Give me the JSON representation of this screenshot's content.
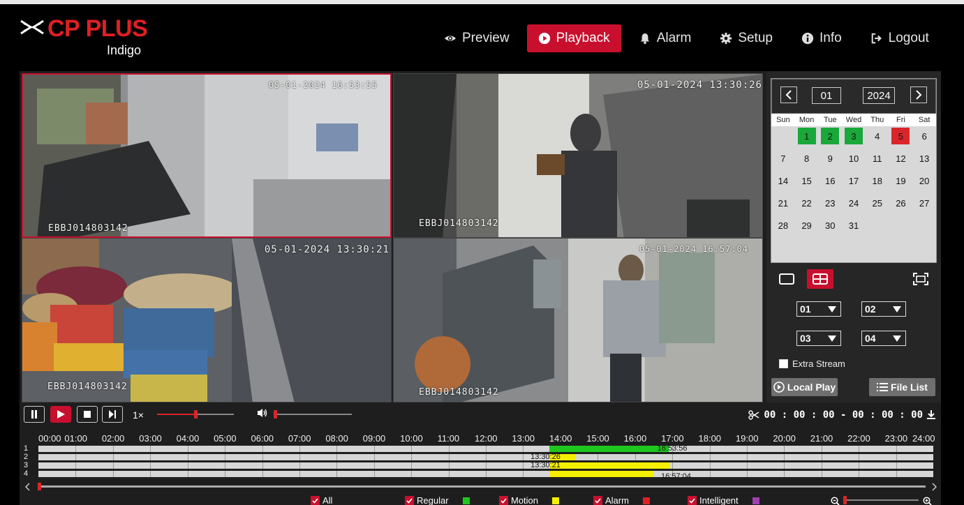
{
  "header": {
    "brand": "CP PLUS",
    "sub_brand": "Indigo",
    "nav": [
      {
        "label": "Preview",
        "icon": "eye-icon"
      },
      {
        "label": "Playback",
        "icon": "play-circle-icon",
        "active": true
      },
      {
        "label": "Alarm",
        "icon": "bell-icon"
      },
      {
        "label": "Setup",
        "icon": "gear-icon"
      },
      {
        "label": "Info",
        "icon": "info-icon"
      },
      {
        "label": "Logout",
        "icon": "logout-icon"
      }
    ]
  },
  "cameras": [
    {
      "timestamp": "05-01-2024 16:53:55",
      "device_id": "EBBJ014803142",
      "selected": true
    },
    {
      "timestamp": "05-01-2024 13:30:26",
      "device_id": "EBBJ014803142"
    },
    {
      "timestamp": "05-01-2024 13:30:21",
      "device_id": "EBBJ014803142"
    },
    {
      "timestamp": "05-01-2024 16:57:04",
      "device_id": "EBBJ014803142"
    }
  ],
  "calendar": {
    "month": "01",
    "year": "2024",
    "weekdays": [
      "Sun",
      "Mon",
      "Tue",
      "Wed",
      "Thu",
      "Fri",
      "Sat"
    ],
    "first_weekday": 1,
    "days_in_month": 31,
    "recorded_days": [
      1,
      2,
      3
    ],
    "selected_day": 5
  },
  "channels": {
    "slot1": "01",
    "slot2": "02",
    "slot3": "03",
    "slot4": "04"
  },
  "extra_stream_label": "Extra Stream",
  "local_play_label": "Local Play",
  "file_list_label": "File List",
  "controls": {
    "speed": "1×",
    "progress": 0.5,
    "volume": 0.0,
    "clip_range": "00 : 00 : 00 - 00 : 00 : 00"
  },
  "timeline": {
    "hours": [
      "00:00",
      "01:00",
      "02:00",
      "03:00",
      "04:00",
      "05:00",
      "06:00",
      "07:00",
      "08:00",
      "09:00",
      "10:00",
      "11:00",
      "12:00",
      "13:00",
      "14:00",
      "15:00",
      "16:00",
      "17:00",
      "18:00",
      "19:00",
      "20:00",
      "21:00",
      "22:00",
      "23:00",
      "24:00"
    ],
    "tracks": [
      "1",
      "2",
      "3",
      "4"
    ],
    "marker_times": [
      "16:53:56",
      "13:30:26",
      "13:30:21",
      "16:57:04"
    ],
    "legend": [
      {
        "label": "All",
        "color": null
      },
      {
        "label": "Regular",
        "color": "#1ec81e"
      },
      {
        "label": "Motion",
        "color": "#f5f000"
      },
      {
        "label": "Alarm",
        "color": "#e01f26"
      },
      {
        "label": "Intelligent",
        "color": "#a040b0"
      }
    ]
  },
  "colors": {
    "brand_red": "#e01f26",
    "active_red": "#c8102e",
    "record_green": "#1aa83a"
  }
}
